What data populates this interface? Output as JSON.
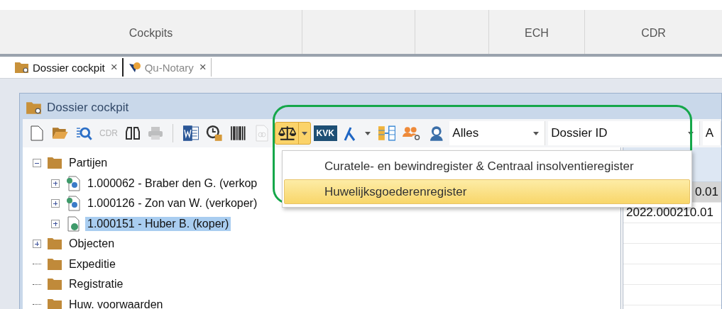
{
  "ribbon": {
    "groups": [
      "Cockpits",
      "ECH",
      "CDR"
    ]
  },
  "tabs": [
    {
      "label": "Dossier cockpit",
      "close": "×",
      "selected": true
    },
    {
      "label": "Qu-Notary",
      "close": "×",
      "selected": false
    }
  ],
  "window": {
    "title": "Dossier cockpit"
  },
  "toolbar": {
    "items": [
      {
        "kind": "new",
        "pressed": false,
        "disabled": false
      },
      {
        "kind": "open",
        "pressed": false,
        "disabled": false
      },
      {
        "kind": "find",
        "pressed": false,
        "disabled": false
      },
      {
        "kind": "text",
        "label": "CDR",
        "pressed": false,
        "disabled": true
      },
      {
        "kind": "binoculars",
        "pressed": false,
        "disabled": false
      },
      {
        "kind": "print",
        "pressed": false,
        "disabled": true
      },
      {
        "kind": "sep"
      },
      {
        "kind": "word",
        "pressed": false,
        "disabled": false
      },
      {
        "kind": "clock",
        "pressed": false,
        "disabled": false
      },
      {
        "kind": "barcode",
        "pressed": false,
        "disabled": false
      },
      {
        "kind": "attach",
        "pressed": false,
        "disabled": true
      },
      {
        "kind": "scales",
        "pressed": true,
        "disabled": false
      },
      {
        "kind": "badge",
        "label": "KVK",
        "pressed": false,
        "disabled": false
      },
      {
        "kind": "lambda",
        "pressed": false,
        "disabled": false
      },
      {
        "kind": "caret",
        "pressed": false,
        "disabled": false
      },
      {
        "kind": "columns",
        "pressed": false,
        "disabled": false
      },
      {
        "kind": "people",
        "pressed": false,
        "disabled": false
      },
      {
        "kind": "support",
        "pressed": false,
        "disabled": false
      }
    ],
    "combos": [
      {
        "value": "Alles"
      },
      {
        "value": "Dossier ID"
      },
      {
        "value": "A"
      }
    ]
  },
  "menu": {
    "items": [
      {
        "label": "Curatele- en bewindregister & Centraal insolventieregister",
        "selected": false
      },
      {
        "label": "Huwelijksgoederenregister",
        "selected": true
      }
    ]
  },
  "tree": [
    {
      "label": "Partijen",
      "expanded": true,
      "selected": false,
      "children": [
        {
          "label": "1.000062 - Braber den G. (verkop",
          "expanded": false,
          "selected": false
        },
        {
          "label": "1.000126 - Zon van W. (verkoper)",
          "expanded": false,
          "selected": false
        },
        {
          "label": "1.000151 - Huber B. (koper)",
          "expanded": false,
          "selected": true
        }
      ]
    },
    {
      "label": "Objecten",
      "expanded": false,
      "selected": false
    },
    {
      "label": "Expeditie",
      "selected": false
    },
    {
      "label": "Registratie",
      "selected": false
    },
    {
      "label": "Huw. voorwaarden",
      "selected": false
    }
  ],
  "grid": {
    "rows": [
      {
        "text": "0.01",
        "selected": true
      },
      {
        "text": "2022.000210.01",
        "selected": false
      }
    ]
  }
}
